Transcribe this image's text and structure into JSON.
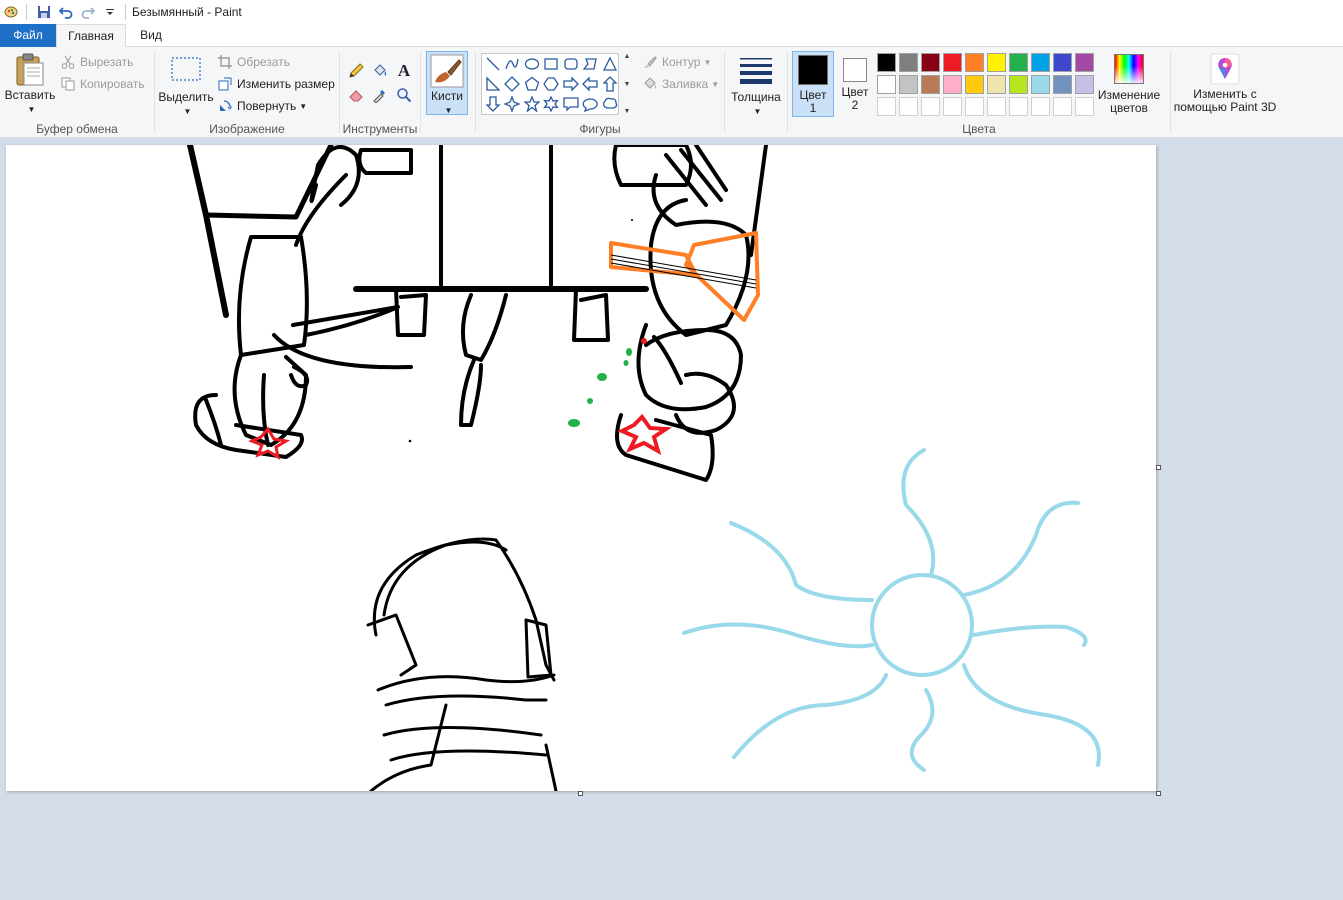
{
  "window": {
    "title": "Безымянный - Paint"
  },
  "tabs": {
    "file": "Файл",
    "home": "Главная",
    "view": "Вид"
  },
  "clipboard": {
    "paste": "Вставить",
    "cut": "Вырезать",
    "copy": "Копировать",
    "label": "Буфер обмена"
  },
  "image": {
    "select": "Выделить",
    "crop": "Обрезать",
    "resize": "Изменить размер",
    "rotate": "Повернуть",
    "label": "Изображение"
  },
  "tools": {
    "label": "Инструменты",
    "text_glyph": "A"
  },
  "brushes": {
    "label": "Кисти"
  },
  "shapes": {
    "outline": "Контур",
    "fill": "Заливка",
    "label": "Фигуры"
  },
  "thickness": {
    "label": "Толщина"
  },
  "colors": {
    "color1_line1": "Цвет",
    "color1_line2": "1",
    "color2_line1": "Цвет",
    "color2_line2": "2",
    "edit_line1": "Изменение",
    "edit_line2": "цветов",
    "label": "Цвета",
    "color1_value": "#000000",
    "color2_value": "#ffffff",
    "palette_row1": [
      "#000000",
      "#7f7f7f",
      "#880015",
      "#ed1c24",
      "#ff7f27",
      "#fff200",
      "#22b14c",
      "#00a2e8",
      "#3f48cc",
      "#a349a4"
    ],
    "palette_row2": [
      "#ffffff",
      "#c3c3c3",
      "#b97a57",
      "#ffaec9",
      "#ffc90e",
      "#efe4b0",
      "#b5e61d",
      "#99d9ea",
      "#7092be",
      "#c8bfe7"
    ]
  },
  "paint3d": {
    "line1": "Изменить с",
    "line2": "помощью Paint 3D"
  }
}
